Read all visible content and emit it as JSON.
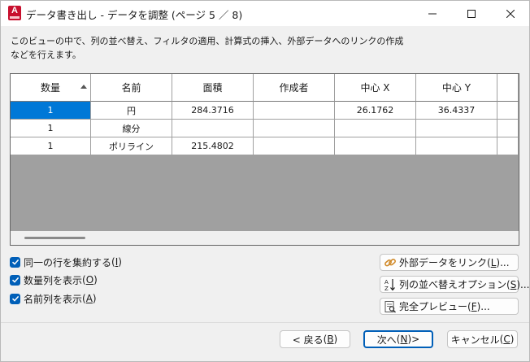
{
  "window": {
    "title": "データ書き出し - データを調整 (ページ 5 ／ 8)",
    "app_icon_letter": "A",
    "accent_color": "#c8102e"
  },
  "description": {
    "line1": "このビューの中で、列の並べ替え、フィルタの適用、計算式の挿入、外部データへのリンクの作成",
    "line2": "などを行えます。"
  },
  "grid": {
    "columns": [
      "数量",
      "名前",
      "面積",
      "作成者",
      "中心 X",
      "中心 Y",
      ""
    ],
    "sorted_column_index": 0,
    "rows": [
      [
        "1",
        "円",
        "284.3716",
        "",
        "26.1762",
        "36.4337",
        ""
      ],
      [
        "1",
        "線分",
        "",
        "",
        "",
        "",
        ""
      ],
      [
        "1",
        "ポリライン",
        "215.4802",
        "",
        "",
        "",
        ""
      ]
    ],
    "selected_cell": {
      "row": 0,
      "col": 0
    },
    "selection_color": "#0078d7"
  },
  "options": {
    "combine_rows": {
      "label": "同一の行を集約する",
      "key": "I",
      "checked": true
    },
    "show_count": {
      "label": "数量列を表示",
      "key": "O",
      "checked": true
    },
    "show_name": {
      "label": "名前列を表示",
      "key": "A",
      "checked": true
    }
  },
  "side_buttons": {
    "link_external": {
      "label": "外部データをリンク",
      "key": "L",
      "suffix": "..."
    },
    "sort_options": {
      "label": "列の並べ替えオプション",
      "key": "S",
      "suffix": "..."
    },
    "full_preview": {
      "label": "完全プレビュー",
      "key": "F",
      "suffix": "..."
    }
  },
  "footer": {
    "back": {
      "label": "< 戻る",
      "key": "B"
    },
    "next": {
      "label": "次へ",
      "key": "N",
      "suffix": " >"
    },
    "cancel": {
      "label": "キャンセル",
      "key": "C"
    }
  },
  "icons": {
    "minimize": "minimize-icon",
    "maximize": "maximize-icon",
    "close": "close-icon",
    "link": "link-icon",
    "sort": "sort-az-icon",
    "preview": "preview-icon"
  }
}
